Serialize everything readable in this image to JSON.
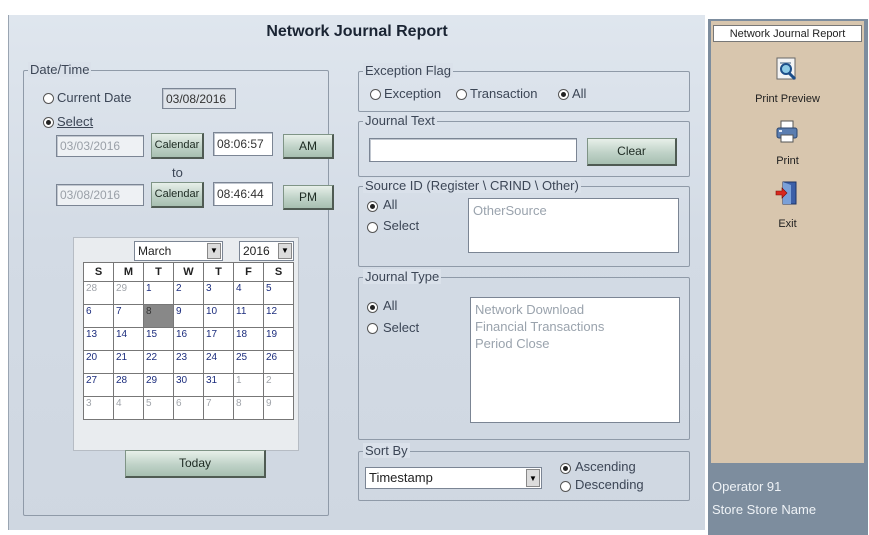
{
  "window": {
    "title": "Network Journal Report"
  },
  "datetime": {
    "legend": "Date/Time",
    "current_date_label": "Current Date",
    "current_date_value": "03/08/2016",
    "select_label": "Select",
    "from_date": "03/03/2016",
    "from_time": "08:06:57",
    "from_ampm": "AM",
    "to_label": "to",
    "to_date": "03/08/2016",
    "to_time": "08:46:44",
    "to_ampm": "PM",
    "calendar_button": "Calendar",
    "today_button": "Today"
  },
  "calendar": {
    "month": "March",
    "year": "2016",
    "weekdays": [
      "S",
      "M",
      "T",
      "W",
      "T",
      "F",
      "S"
    ],
    "weeks": [
      [
        "28",
        "29",
        "1",
        "2",
        "3",
        "4",
        "5"
      ],
      [
        "6",
        "7",
        "8",
        "9",
        "10",
        "11",
        "12"
      ],
      [
        "13",
        "14",
        "15",
        "16",
        "17",
        "18",
        "19"
      ],
      [
        "20",
        "21",
        "22",
        "23",
        "24",
        "25",
        "26"
      ],
      [
        "27",
        "28",
        "29",
        "30",
        "31",
        "1",
        "2"
      ],
      [
        "3",
        "4",
        "5",
        "6",
        "7",
        "8",
        "9"
      ]
    ]
  },
  "exception_flag": {
    "legend": "Exception Flag",
    "options": [
      "Exception",
      "Transaction",
      "All"
    ],
    "selected": "All"
  },
  "journal_text": {
    "legend": "Journal Text",
    "value": "",
    "clear_button": "Clear"
  },
  "source_id": {
    "legend": "Source ID (Register \\ CRIND \\ Other)",
    "all_label": "All",
    "select_label": "Select",
    "items": [
      "OtherSource"
    ]
  },
  "journal_type": {
    "legend": "Journal Type",
    "all_label": "All",
    "select_label": "Select",
    "items": [
      "Network Download",
      "Financial Transactions",
      "Period Close"
    ]
  },
  "sort_by": {
    "legend": "Sort By",
    "value": "Timestamp",
    "ascending_label": "Ascending",
    "descending_label": "Descending"
  },
  "sidebar": {
    "header": "Network Journal Report",
    "print_preview": "Print Preview",
    "print": "Print",
    "exit": "Exit",
    "operator": "Operator 91",
    "store": "Store Store Name"
  }
}
